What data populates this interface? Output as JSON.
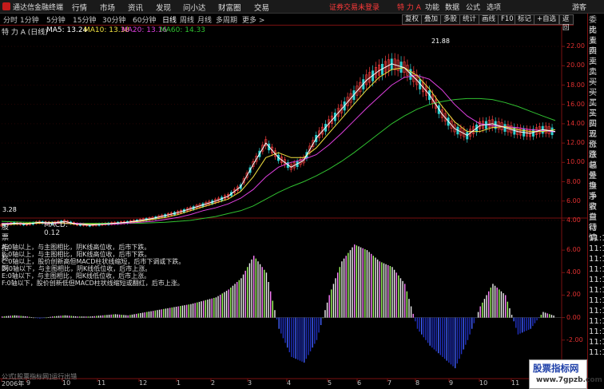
{
  "titlebar": {
    "app_name": "通达信金融终端",
    "menus": [
      "行情",
      "市场",
      "资讯",
      "发现",
      "问小达",
      "财富圈",
      "交易"
    ],
    "warning": "证券交易未登录",
    "stock": "特 力 A",
    "right_items": [
      "功能",
      "数据",
      "公式",
      "选项"
    ],
    "guest": "游客"
  },
  "periods": [
    "分时",
    "1分钟",
    "5分钟",
    "15分钟",
    "30分钟",
    "60分钟",
    "日线",
    "周线",
    "月线",
    "多周期",
    "更多 >"
  ],
  "active_period": "日线",
  "tools": [
    "复权",
    "叠加",
    "多股",
    "统计",
    "画线",
    "F10",
    "标记",
    "+自选",
    "返回"
  ],
  "info": {
    "stock_label": "特 力 A (日线)",
    "ma5": "MA5: 13.24",
    "ma10": "MA10: 13.38",
    "ma20": "MA20: 13.16",
    "ma60": "MA60: 14.33"
  },
  "colors": {
    "ma5": "#ffffff",
    "ma10": "#f0e040",
    "ma20": "#e040e0",
    "ma60": "#30c030",
    "up": "#ff4040",
    "down": "#30d0d0",
    "accent": "#e03030"
  },
  "price_axis": [
    "22.00",
    "20.00",
    "18.00",
    "16.00",
    "14.00",
    "12.00",
    "10.00",
    "8.00",
    "6.00",
    "4.00"
  ],
  "price_annotations": {
    "high": "21.88",
    "low": "3.28"
  },
  "macd": {
    "title": "股票指标网",
    "label": "MACD: 0.12",
    "axis": [
      "6.00",
      "4.00",
      "2.00",
      "0.00",
      "-2.00"
    ]
  },
  "macd_notes": [
    "A:0轴以上，与主图相比，阴K线高位收，后市下跌。",
    "B:0轴以上，与主图相比，阳K线高位收，后市下跌。",
    "C:0轴以上，股价创新高但MACD柱状线缩短，后市下调或下跌。",
    "D:0轴以下，与主图相比，阴K线低位收，后市上涨。",
    "E:0轴以下，与主图相比，阳K线低位收，后市上涨。",
    "F:0轴以下，股价创新低但MACD柱状线缩短或翻红，后市上涨。"
  ],
  "formula_note": "公式[股票指标网]运行出错",
  "dates": [
    "2006年",
    "9",
    "10",
    "11",
    "12",
    "1",
    "2",
    "3",
    "4",
    "5",
    "6",
    "7",
    "8",
    "9",
    "10",
    "11"
  ],
  "sidebar": [
    "委比",
    "卖五",
    "卖四",
    "卖三",
    "卖二",
    "卖一",
    "买一",
    "买二",
    "买三",
    "买四",
    "买五",
    "现价",
    "涨跌",
    "涨幅",
    "总量",
    "外盘",
    "换手",
    "净资",
    "收益",
    "自动",
    "行情",
    "11:1",
    "11:1",
    "11:1",
    "11:1",
    "11:1",
    "11:1",
    "11:1",
    "11:1",
    "11:1",
    "11:1",
    "11:1",
    "11:1"
  ],
  "watermark": {
    "line1": "股票指标网",
    "line2": "www.7gpzb.com"
  },
  "chart_data": {
    "type": "candlestick",
    "price_range": [
      3,
      23
    ],
    "ma_series": {
      "ma5": [
        3.5,
        3.7,
        3.6,
        3.8,
        3.7,
        3.9,
        3.6,
        3.5,
        3.6,
        3.7,
        3.8,
        4.0,
        4.2,
        4.5,
        4.8,
        5.2,
        5.6,
        6.0,
        6.5,
        7.5,
        9.8,
        12.0,
        10.5,
        9.5,
        10.2,
        12.5,
        14.0,
        15.5,
        17.0,
        18.5,
        19.5,
        20.2,
        19.8,
        18.5,
        17.0,
        15.0,
        13.5,
        12.8,
        13.8,
        14.0,
        13.6,
        13.2,
        13.0,
        13.4,
        13.2
      ],
      "ma10": [
        3.6,
        3.6,
        3.7,
        3.7,
        3.8,
        3.7,
        3.6,
        3.6,
        3.6,
        3.7,
        3.8,
        3.9,
        4.1,
        4.3,
        4.6,
        5.0,
        5.4,
        5.8,
        6.2,
        7.0,
        8.5,
        10.5,
        11.0,
        10.5,
        10.5,
        11.5,
        13.0,
        14.5,
        16.0,
        17.5,
        18.8,
        19.6,
        19.8,
        19.0,
        17.6,
        15.8,
        14.2,
        13.2,
        13.2,
        13.6,
        13.7,
        13.4,
        13.2,
        13.2,
        13.38
      ],
      "ma20": [
        3.7,
        3.7,
        3.7,
        3.7,
        3.7,
        3.7,
        3.7,
        3.6,
        3.6,
        3.6,
        3.7,
        3.8,
        3.9,
        4.1,
        4.3,
        4.6,
        5.0,
        5.3,
        5.7,
        6.3,
        7.2,
        8.5,
        9.5,
        10.0,
        10.3,
        10.8,
        11.8,
        13.0,
        14.3,
        15.6,
        16.8,
        18.0,
        18.8,
        19.0,
        18.6,
        17.5,
        16.0,
        14.8,
        14.0,
        13.8,
        13.7,
        13.6,
        13.4,
        13.3,
        13.16
      ],
      "ma60": [
        3.9,
        3.85,
        3.8,
        3.8,
        3.75,
        3.7,
        3.7,
        3.7,
        3.7,
        3.7,
        3.7,
        3.7,
        3.75,
        3.8,
        3.9,
        4.0,
        4.2,
        4.4,
        4.7,
        5.0,
        5.5,
        6.2,
        6.9,
        7.5,
        8.0,
        8.6,
        9.3,
        10.1,
        11.0,
        12.0,
        13.0,
        14.0,
        14.8,
        15.5,
        16.0,
        16.3,
        16.5,
        16.6,
        16.6,
        16.5,
        16.2,
        15.8,
        15.3,
        14.8,
        14.33
      ]
    },
    "macd_histogram": [
      0.1,
      0.2,
      0.1,
      -0.1,
      0.1,
      0.2,
      0.1,
      0.1,
      0.2,
      0.3,
      0.2,
      0.4,
      0.6,
      0.8,
      1.0,
      1.2,
      1.5,
      1.8,
      2.5,
      3.5,
      5.5,
      4.0,
      -1.0,
      -3.5,
      -4.0,
      -2.0,
      2.0,
      5.0,
      6.5,
      6.0,
      5.0,
      4.5,
      3.0,
      -1.0,
      -2.5,
      -3.5,
      -4.5,
      -2.0,
      1.0,
      3.0,
      2.0,
      -1.5,
      -1.0,
      0.5,
      0.12
    ]
  }
}
